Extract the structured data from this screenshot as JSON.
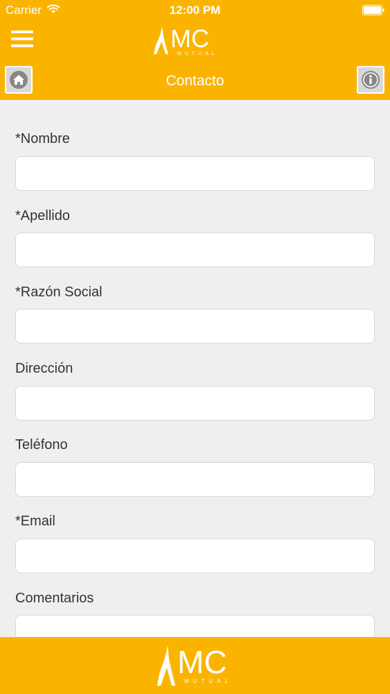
{
  "status_bar": {
    "carrier": "Carrier",
    "time": "12:00 PM"
  },
  "header": {
    "logo_text": "MC",
    "logo_subtext": "MUTUAL",
    "title": "Contacto",
    "icons": {
      "menu": "hamburger-menu-icon",
      "home": "home-icon",
      "info": "info-icon"
    }
  },
  "form": {
    "fields": [
      {
        "label": "*Nombre",
        "value": ""
      },
      {
        "label": "*Apellido",
        "value": ""
      },
      {
        "label": "*Razón Social",
        "value": ""
      },
      {
        "label": "Dirección",
        "value": ""
      },
      {
        "label": "Teléfono",
        "value": ""
      },
      {
        "label": "*Email",
        "value": ""
      },
      {
        "label": "Comentarios",
        "value": ""
      }
    ]
  },
  "footer": {
    "logo_text": "MC",
    "logo_subtext": "MUTUAL"
  },
  "colors": {
    "brand": "#fab400",
    "background": "#efeff0",
    "text": "#333333"
  }
}
